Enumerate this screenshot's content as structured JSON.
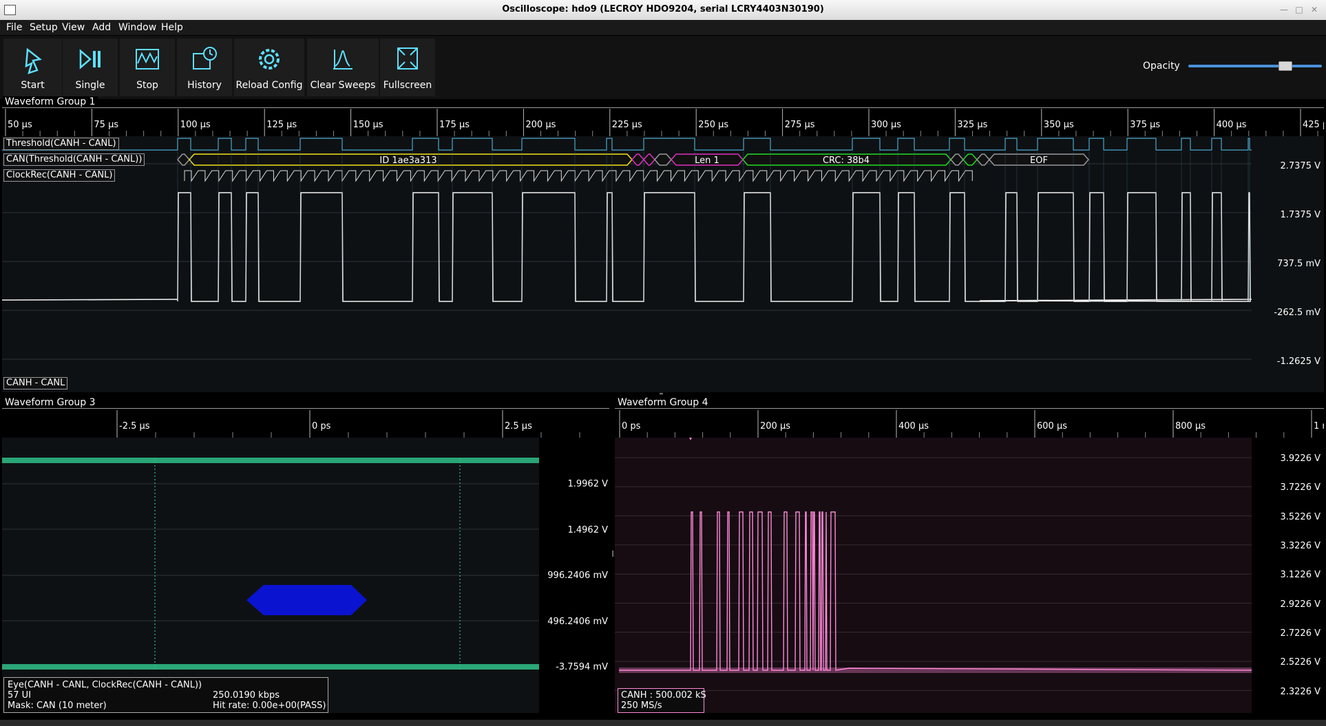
{
  "window": {
    "title": "Oscilloscope: hdo9 (LECROY HDO9204, serial LCRY4403N30190)"
  },
  "menu": [
    "File",
    "Setup",
    "View",
    "Add",
    "Window",
    "Help"
  ],
  "toolbar": {
    "buttons": [
      {
        "label": "Start",
        "icon": "play-icon"
      },
      {
        "label": "Single",
        "icon": "single-icon"
      },
      {
        "label": "Stop",
        "icon": "stop-icon"
      },
      {
        "label": "History",
        "icon": "history-icon"
      },
      {
        "label": "Reload Config",
        "icon": "gear-icon"
      },
      {
        "label": "Clear Sweeps",
        "icon": "clear-sweeps-icon"
      },
      {
        "label": "Fullscreen",
        "icon": "fullscreen-icon"
      }
    ],
    "opacity_label": "Opacity",
    "opacity_value": 0.72
  },
  "group1": {
    "title": "Waveform Group 1",
    "ticks": [
      "50 µs",
      "75 µs",
      "100 µs",
      "125 µs",
      "150 µs",
      "175 µs",
      "200 µs",
      "225 µs",
      "250 µs",
      "275 µs",
      "300 µs",
      "325 µs",
      "350 µs",
      "375 µs",
      "400 µs",
      "425 µs"
    ],
    "channels": [
      "Threshold(CANH - CANL)",
      "CAN(Threshold(CANH - CANL))",
      "ClockRec(CANH - CANL)"
    ],
    "decode": {
      "id": "ID 1ae3a313",
      "len": "Len 1",
      "crc": "CRC: 38b4",
      "eof": "EOF"
    },
    "vlabels": [
      "2.7375 V",
      "1.7375 V",
      "737.5 mV",
      "-262.5 mV",
      "-1.2625 V"
    ],
    "trace_label": "CANH - CANL"
  },
  "group3": {
    "title": "Waveform Group 3",
    "ticks": [
      "-2.5 µs",
      "0 ps",
      "2.5 µs"
    ],
    "vlabels": [
      "1.9962 V",
      "1.4962 V",
      "996.2406 mV",
      "496.2406 mV",
      "-3.7594 mV"
    ],
    "info": {
      "name": "Eye(CANH - CANL, ClockRec(CANH - CANL))",
      "ui": "57 UI",
      "rate": "250.0190 kbps",
      "mask": "Mask: CAN (10 meter)",
      "hit": "Hit rate: 0.00e+00(PASS)"
    },
    "colors": {
      "eye": "#2fbf8a",
      "mask": "#0a14d0"
    }
  },
  "group4": {
    "title": "Waveform Group 4",
    "ticks": [
      "0 ps",
      "200 µs",
      "400 µs",
      "600 µs",
      "800 µs",
      "1 r"
    ],
    "vlabels": [
      "3.9226 V",
      "3.7226 V",
      "3.5226 V",
      "3.3226 V",
      "3.1226 V",
      "2.9226 V",
      "2.7226 V",
      "2.5226 V",
      "2.3226 V"
    ],
    "info": {
      "line1": "CANH : 500.002 kS",
      "line2": "250 MS/s"
    },
    "colors": {
      "trace": "#ff88d8"
    }
  }
}
